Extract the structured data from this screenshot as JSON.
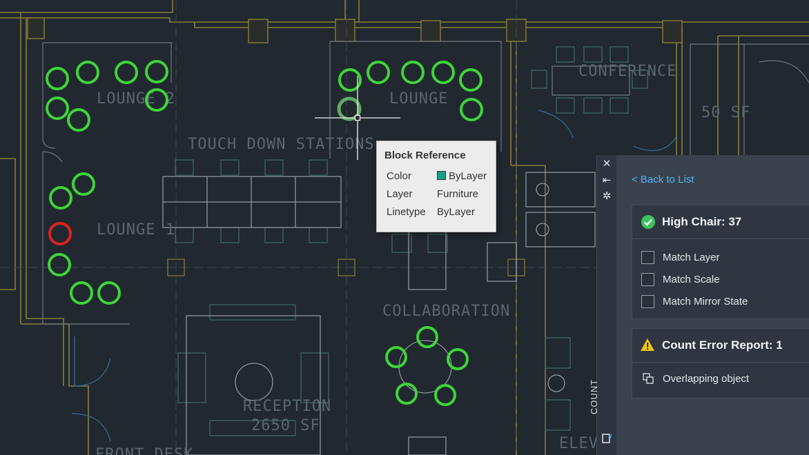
{
  "floorplan": {
    "rooms": [
      "LOUNGE 2",
      "LOUNGE",
      "TOUCH DOWN STATIONS",
      "CONFERENCE",
      "50 SF",
      "LOUNGE 1",
      "COLLABORATION",
      "RECEPTION",
      "2650 SF",
      "FRONT DESK",
      "ELEV"
    ]
  },
  "tooltip": {
    "title": "Block Reference",
    "rows": [
      {
        "label": "Color",
        "value": "ByLayer"
      },
      {
        "label": "Layer",
        "value": "Furniture"
      },
      {
        "label": "Linetype",
        "value": "ByLayer"
      }
    ],
    "swatch_color": "#18a089"
  },
  "panel": {
    "strip_label": "COUNT",
    "back_link": "< Back to List",
    "count_card": {
      "title": "High Chair: 37",
      "status_icon": "check-circle-icon",
      "options": [
        {
          "label": "Match Layer",
          "checked": false
        },
        {
          "label": "Match Scale",
          "checked": false
        },
        {
          "label": "Match Mirror State",
          "checked": false
        }
      ]
    },
    "error_card": {
      "title": "Count Error Report: 1",
      "status_icon": "warning-icon",
      "items": [
        {
          "label": "Overlapping object",
          "icon": "overlap-icon"
        }
      ]
    }
  },
  "colors": {
    "background": "#212830",
    "count_highlight": "#3fd43a",
    "error_highlight": "#e02020",
    "link": "#4fb3f0",
    "warning": "#f0c419"
  }
}
